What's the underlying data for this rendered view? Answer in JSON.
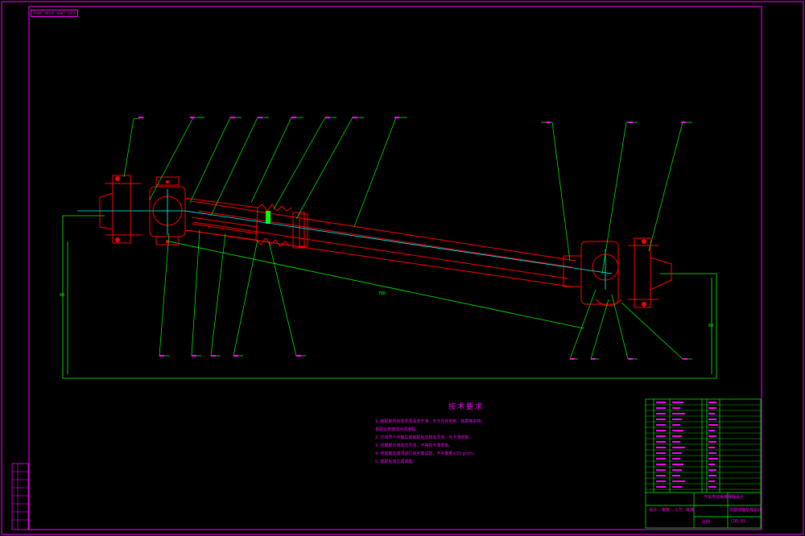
{
  "drawing": {
    "corner_tag": "FRONT DRIVE SHAFT ASSY",
    "dimension_length": "780",
    "dimension_vertical_left": "80",
    "dimension_vertical_right": "88"
  },
  "notes": {
    "title": "技术要求",
    "items": [
      "1. 装配前所有零件须清洗干净，不允许有毛刺、铁屑等杂物，",
      "   各配合表面须涂润滑脂。",
      "2. 万向节十字轴总成装配后应转动灵活，无卡滞现象。",
      "3. 花键部分滑动应灵活，不得有卡滞现象。",
      "4. 传动轴总成须进行动平衡试验，不平衡量≤30 g·cm。",
      "5. 装配后加注润滑脂。"
    ]
  },
  "title_block": {
    "drawing_number": "CDQ-01",
    "project_caption": "前驱动轴总成设计",
    "school_line": "汽车传动系统课程设计",
    "sign_labels": [
      "设计",
      "审核",
      "工艺",
      "批准",
      "比例"
    ]
  },
  "colors": {
    "frame": "#ff00ff",
    "shaft": "#ff0000",
    "leaders": "#00ff00",
    "centerline": "#00ffff",
    "highlight": "#00ff00"
  }
}
